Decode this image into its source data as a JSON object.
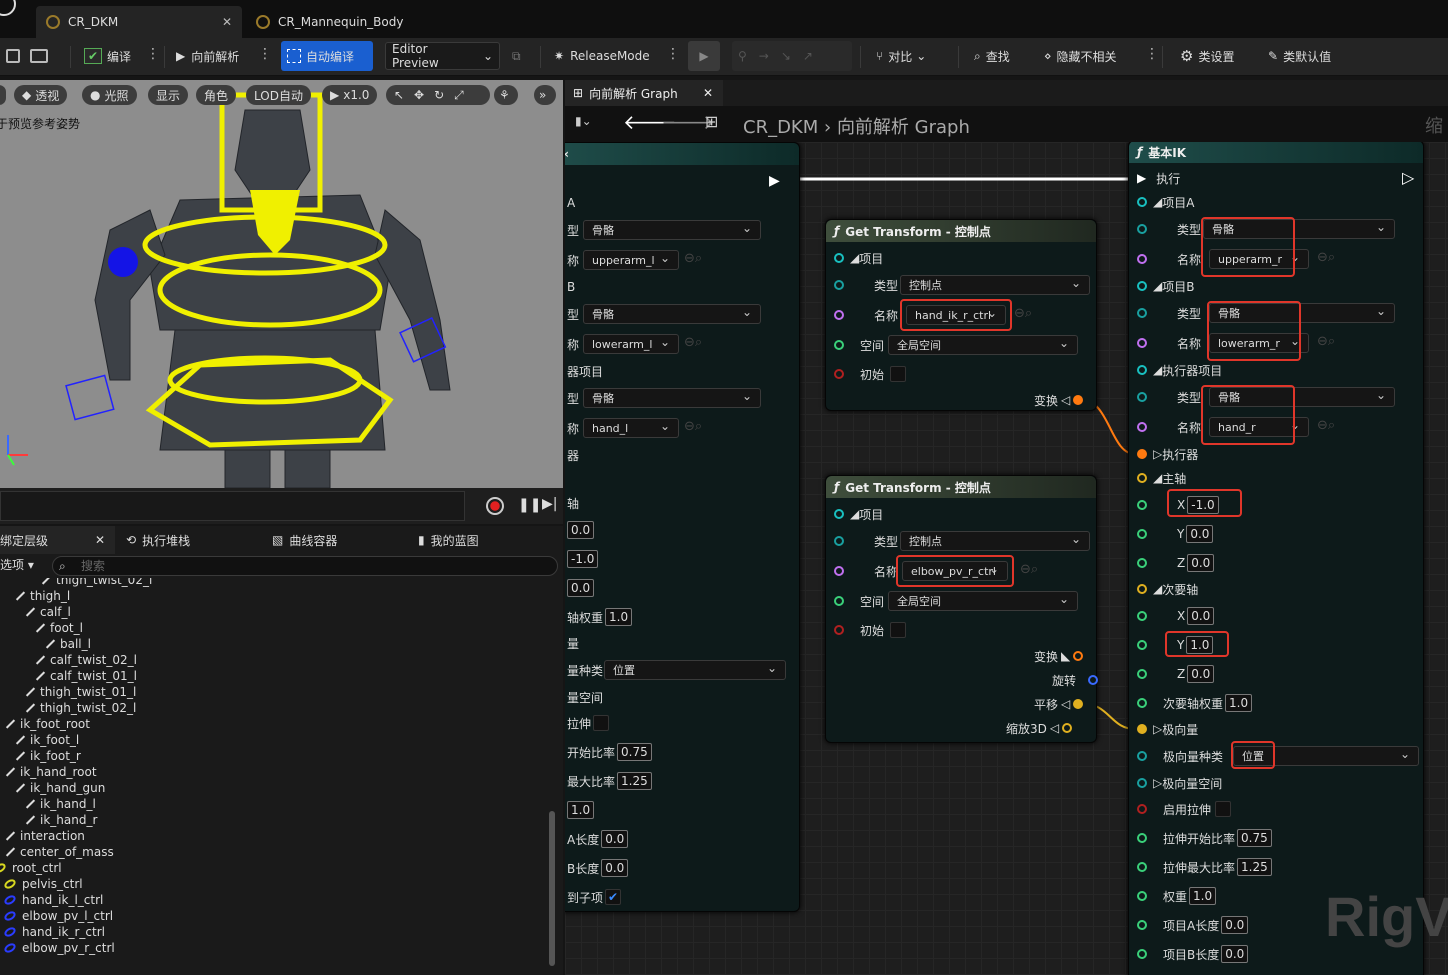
{
  "tabs": [
    {
      "label": "CR_DKM"
    },
    {
      "label": "CR_Mannequin_Body"
    }
  ],
  "toolbar": {
    "compile": "编译",
    "forward_solve": "向前解析",
    "auto_compile": "自动编译",
    "preview_mode": "Editor Preview",
    "release_mode": "ReleaseMode",
    "diff": "对比",
    "find": "查找",
    "hide_unrelated": "隐藏不相关",
    "class_settings": "类设置",
    "class_defaults": "类默认值"
  },
  "viewport": {
    "perspective": "透视",
    "lit": "光照",
    "show": "显示",
    "character": "角色",
    "lod": "LOD自动",
    "speed": "x1.0",
    "overlay_text": "于预览参考姿势"
  },
  "panel_tabs": {
    "hierarchy": "绑定层级",
    "exec_stack": "执行堆栈",
    "curve_container": "曲线容器",
    "my_blueprint": "我的蓝图"
  },
  "filter": {
    "options": "选项",
    "search_placeholder": "搜索"
  },
  "tree": [
    {
      "label": "thigh_twist_02_l",
      "indent": 40
    },
    {
      "label": "thigh_l",
      "indent": 14
    },
    {
      "label": "calf_l",
      "indent": 24
    },
    {
      "label": "foot_l",
      "indent": 34
    },
    {
      "label": "ball_l",
      "indent": 44
    },
    {
      "label": "calf_twist_02_l",
      "indent": 34
    },
    {
      "label": "calf_twist_01_l",
      "indent": 34
    },
    {
      "label": "thigh_twist_01_l",
      "indent": 24
    },
    {
      "label": "thigh_twist_02_l",
      "indent": 24
    },
    {
      "label": "ik_foot_root",
      "indent": 4
    },
    {
      "label": "ik_foot_l",
      "indent": 14
    },
    {
      "label": "ik_foot_r",
      "indent": 14
    },
    {
      "label": "ik_hand_root",
      "indent": 4
    },
    {
      "label": "ik_hand_gun",
      "indent": 14
    },
    {
      "label": "ik_hand_l",
      "indent": 24
    },
    {
      "label": "ik_hand_r",
      "indent": 24
    },
    {
      "label": "interaction",
      "indent": 4
    },
    {
      "label": "center_of_mass",
      "indent": 4
    },
    {
      "label": "root_ctrl",
      "indent": -6
    },
    {
      "label": "pelvis_ctrl",
      "indent": 4
    },
    {
      "label": "hand_ik_l_ctrl",
      "indent": 4
    },
    {
      "label": "elbow_pv_l_ctrl",
      "indent": 4
    },
    {
      "label": "hand_ik_r_ctrl",
      "indent": 4
    },
    {
      "label": "elbow_pv_r_ctrl",
      "indent": 4
    }
  ],
  "graph": {
    "tab": "向前解析 Graph",
    "crumb_asset": "CR_DKM",
    "crumb_graph": "向前解析 Graph",
    "corner_text": "缩",
    "watermark": "RigVi"
  },
  "left_node": {
    "labels": [
      "A",
      "型",
      "称",
      "B",
      "型",
      "称",
      "器项目",
      "型",
      "称",
      "器",
      "轴",
      "轴权重",
      "量",
      "量种类",
      "量空间",
      "拉伸",
      "开始比率",
      "最大比率",
      "A长度",
      "B长度",
      "到子项"
    ],
    "type_bone": "骨骼",
    "name_a": "upperarm_l",
    "name_b": "lowerarm_l",
    "name_c": "hand_l",
    "v1": "0.0",
    "v2": "-1.0",
    "v3": "0.0",
    "secondary_weight": "1.0",
    "pole_type": "位置",
    "stretch_start": "0.75",
    "stretch_max": "1.25",
    "weight": "1.0",
    "len_a": "0.0",
    "len_b": "0.0"
  },
  "gt1": {
    "title": "Get Transform - 控制点",
    "item": "项目",
    "type_label": "类型",
    "type_value": "控制点",
    "name_label": "名称",
    "name_value": "hand_ik_r_ctrl",
    "space_label": "空间",
    "space_value": "全局空间",
    "initial_label": "初始",
    "transform_label": "变换"
  },
  "gt2": {
    "title": "Get Transform - 控制点",
    "item": "项目",
    "type_label": "类型",
    "type_value": "控制点",
    "name_label": "名称",
    "name_value": "elbow_pv_r_ctrl",
    "space_label": "空间",
    "space_value": "全局空间",
    "initial_label": "初始",
    "transform_label": "变换",
    "rotation_label": "旋转",
    "translation_label": "平移",
    "scale_label": "缩放3D"
  },
  "ik": {
    "title": "基本IK",
    "execute": "执行",
    "item_a": "项目A",
    "item_b": "项目B",
    "effector_item": "执行器项目",
    "type_label": "类型",
    "name_label": "名称",
    "type_bone": "骨骼",
    "name_a": "upperarm_r",
    "name_b": "lowerarm_r",
    "name_effector": "hand_r",
    "effector": "执行器",
    "primary_axis": "主轴",
    "x": "X",
    "y": "Y",
    "z": "Z",
    "p_x": "-1.0",
    "p_y": "0.0",
    "p_z": "0.0",
    "secondary_axis": "次要轴",
    "s_x": "0.0",
    "s_y": "1.0",
    "s_z": "0.0",
    "secondary_weight_label": "次要轴权重",
    "secondary_weight": "1.0",
    "pole_vector": "极向量",
    "pole_kind_label": "极向量种类",
    "pole_kind": "位置",
    "pole_space": "极向量空间",
    "enable_stretch": "启用拉伸",
    "stretch_start_label": "拉伸开始比率",
    "stretch_start": "0.75",
    "stretch_max_label": "拉伸最大比率",
    "stretch_max": "1.25",
    "weight_label": "权重",
    "weight": "1.0",
    "len_a_label": "项目A长度",
    "len_a": "0.0",
    "len_b_label": "项目B长度",
    "len_b": "0.0"
  },
  "colors": {
    "accent": "#1a5fd0",
    "annotation": "#e0362a",
    "gizmo": "#f0f000"
  }
}
